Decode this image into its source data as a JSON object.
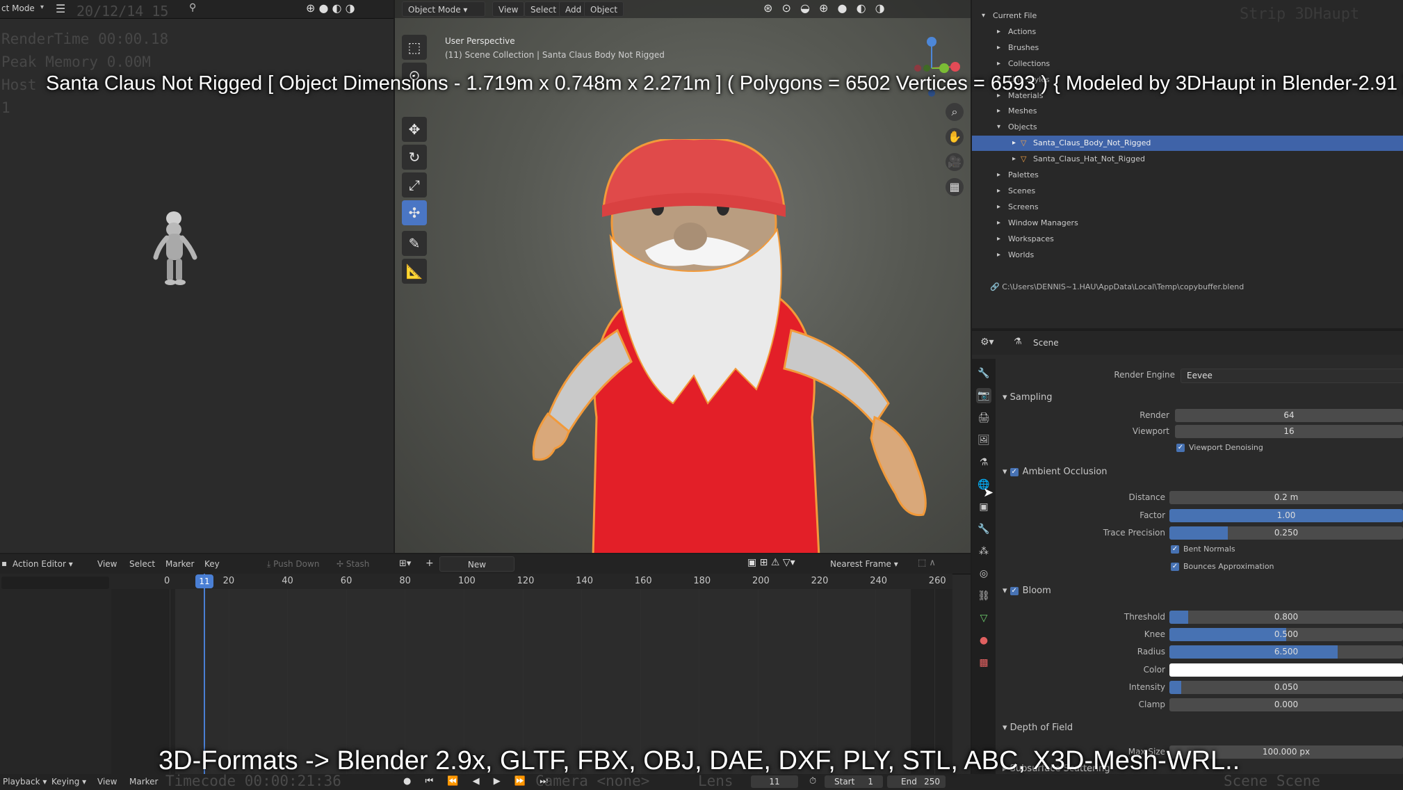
{
  "overlays": {
    "top_caption": "Santa Claus Not Rigged [ Object Dimensions -  1.719m x 0.748m x 2.271m ] ( Polygons = 6502  Vertices = 6593 ) { Modeled by 3DHaupt in Blender-2.91 }",
    "bottom_caption": "3D-Formats -> Blender 2.9x, GLTF, FBX, OBJ, DAE, DXF, PLY, STL, ABC, X3D-Mesh-WRL..",
    "top_right_watermark": "Strip 3DHaupt",
    "bottom_right_watermark": "Scene Scene"
  },
  "left_panel": {
    "mode_label": "ct Mode",
    "header_faint": "20/12/14 15",
    "render_info": [
      "RenderTime 00:00.18",
      "Peak Memory 0.00M",
      "Host",
      "1"
    ]
  },
  "viewport": {
    "mode": "Object Mode",
    "menus": [
      "View",
      "Select",
      "Add",
      "Object"
    ],
    "perspective": "User Perspective",
    "collection": "(11) Scene Collection | Santa Claus Body Not Rigged"
  },
  "outliner": {
    "items": [
      {
        "label": "Current File",
        "indent": 0
      },
      {
        "label": "Actions",
        "indent": 1
      },
      {
        "label": "Brushes",
        "indent": 1
      },
      {
        "label": "Collections",
        "indent": 1
      },
      {
        "label": "Line Styles",
        "indent": 1
      },
      {
        "label": "Materials",
        "indent": 1
      },
      {
        "label": "Meshes",
        "indent": 1
      },
      {
        "label": "Objects",
        "indent": 1
      },
      {
        "label": "Santa_Claus_Body_Not_Rigged",
        "indent": 2,
        "selected": true
      },
      {
        "label": "Santa_Claus_Hat_Not_Rigged",
        "indent": 2
      },
      {
        "label": "Palettes",
        "indent": 1
      },
      {
        "label": "Scenes",
        "indent": 1
      },
      {
        "label": "Screens",
        "indent": 1
      },
      {
        "label": "Window Managers",
        "indent": 1
      },
      {
        "label": "Workspaces",
        "indent": 1
      },
      {
        "label": "Worlds",
        "indent": 1
      }
    ],
    "path": "C:\\Users\\DENNIS~1.HAU\\AppData\\Local\\Temp\\copybuffer.blend"
  },
  "properties": {
    "context": "Scene",
    "render_engine_label": "Render Engine",
    "render_engine": "Eevee",
    "sampling": {
      "title": "Sampling",
      "render_label": "Render",
      "render": "64",
      "viewport_label": "Viewport",
      "viewport": "16",
      "denoise": "Viewport Denoising"
    },
    "ao": {
      "title": "Ambient Occlusion",
      "distance_label": "Distance",
      "distance": "0.2 m",
      "factor_label": "Factor",
      "factor": "1.00",
      "factor_fill": 1.0,
      "trace_label": "Trace Precision",
      "trace": "0.250",
      "trace_fill": 0.25,
      "bent": "Bent Normals",
      "bounces": "Bounces Approximation"
    },
    "bloom": {
      "title": "Bloom",
      "threshold_label": "Threshold",
      "threshold": "0.800",
      "threshold_fill": 0.08,
      "knee_label": "Knee",
      "knee": "0.500",
      "knee_fill": 0.5,
      "radius_label": "Radius",
      "radius": "6.500",
      "radius_fill": 0.72,
      "color_label": "Color",
      "intensity_label": "Intensity",
      "intensity": "0.050",
      "intensity_fill": 0.05,
      "clamp_label": "Clamp",
      "clamp": "0.000"
    },
    "dof": {
      "title": "Depth of Field",
      "max_label": "Max Size",
      "max": "100.000 px"
    },
    "sss": "Subsurface Scattering"
  },
  "timeline": {
    "editor": "Action Editor",
    "menus": [
      "View",
      "Select",
      "Marker",
      "Key"
    ],
    "push_down": "Push Down",
    "stash": "Stash",
    "new": "New",
    "snap": "Nearest Frame",
    "current_frame": "11",
    "ticks": [
      "0",
      "20",
      "40",
      "60",
      "80",
      "100",
      "120",
      "140",
      "160",
      "180",
      "200",
      "220",
      "240",
      "260"
    ]
  },
  "statusbar": {
    "playback": "Playback",
    "keying": "Keying",
    "view": "View",
    "marker": "Marker",
    "timecode": "Timecode 00:00:21:36",
    "camera": "Camera <none>",
    "lens": "Lens",
    "frame": "11",
    "start_label": "Start",
    "start": "1",
    "end_label": "End",
    "end": "250"
  }
}
